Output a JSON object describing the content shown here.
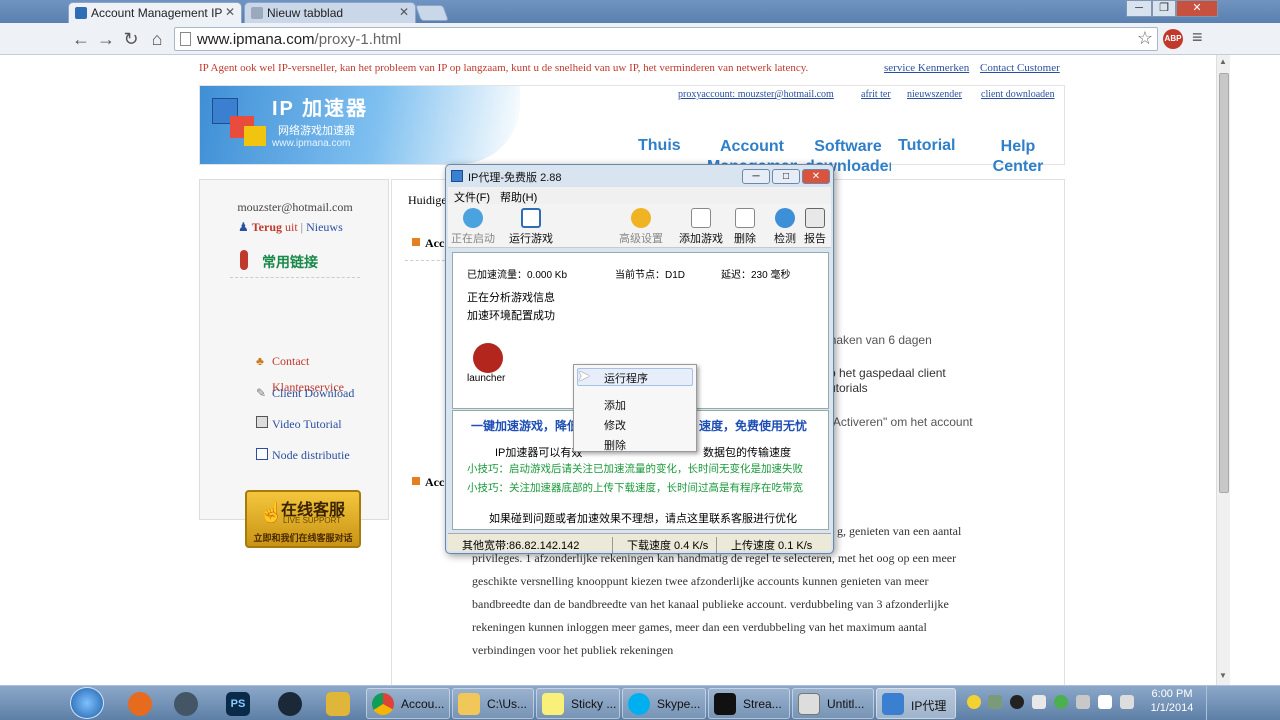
{
  "browser": {
    "tabs": [
      {
        "label": "Account Management IP"
      },
      {
        "label": "Nieuw tabblad"
      }
    ],
    "url_host": "www.ipmana.com",
    "url_path": "/proxy-1.html",
    "abp_label": "ABP"
  },
  "page": {
    "top_notice": "IP Agent ook wel IP-versneller, kan het probleem van IP op langzaam, kunt u de snelheid van uw IP, het verminderen van netwerk latency.",
    "top_links": [
      "service Kenmerken",
      "Contact Customer"
    ],
    "logo": {
      "title": "IP 加速器",
      "subtitle": "网络游戏加速器",
      "url": "www.ipmana.com"
    },
    "header_links": [
      "proxyaccount: mouzster@hotmail.com",
      "afrit ter",
      "nieuwszender",
      "client downloaden"
    ],
    "main_nav": [
      "Thuis",
      "Account Management",
      "Software downloaden",
      "Tutorial",
      "Help Center"
    ],
    "sidebar": {
      "email": "mouzster@hotmail.com",
      "back_label": "Terug",
      "uit": "uit",
      "sep": "|",
      "news": "Nieuws",
      "section_title": "常用链接",
      "links": [
        "Contact",
        "Klantenservice",
        "Client Download",
        "Video Tutorial",
        "Node distributie"
      ],
      "chat": {
        "title": "在线客服",
        "sub": "LIVE SUPPORT",
        "footer": "立即和我们在线客服对话"
      }
    },
    "content": {
      "huidige": "Huidige",
      "acc1": "Acc",
      "acc2": "Acc",
      "text_right_1": "k maken van 6 dagen",
      "text_right_2a": "p het gaspedaal client",
      "text_right_2b": "utorials",
      "text_right_3": "\" Activeren\" om het account",
      "text_right_4": "g, genieten van een aantal",
      "paragraph": [
        "privileges. 1 afzonderlijke rekeningen kan handmatig de regel te selecteren, met het oog op een meer",
        "geschikte versnelling knooppunt kiezen twee afzonderlijke accounts kunnen genieten van meer",
        "bandbreedte dan de bandbreedte van het kanaal publieke account. verdubbeling van 3 afzonderlijke",
        "rekeningen kunnen inloggen meer games, meer dan een verdubbeling van het maximum aantal",
        "verbindingen voor het publiek rekeningen"
      ]
    }
  },
  "dialog": {
    "title": "IP代理-免费版 2.88",
    "menu": [
      "文件(F)",
      "帮助(H)"
    ],
    "tools": [
      "正在启动",
      "运行游戏",
      "高级设置",
      "添加游戏",
      "删除",
      "检测",
      "报告"
    ],
    "stats": {
      "accel_label": "已加速流量：",
      "accel_value": "0.000 Kb",
      "node_label": "当前节点：",
      "node_value": "D1D",
      "latency_label": "延迟：",
      "latency_value": "230 毫秒"
    },
    "log": [
      "正在分析游戏信息",
      "加速环境配置成功"
    ],
    "game_label": "launcher",
    "promo_title": "一键加速游戏，降低",
    "promo_title_right": "速度，免费使用无忧",
    "promo_line1": "IP加速器可以有效",
    "promo_line1_right": "数据包的传输速度",
    "tip1": "小技巧：启动游戏后请关注已加速流量的变化，长时间无变化是加速失败",
    "tip2": "小技巧：关注加速器底部的上传下载速度，长时间过高是有程序在吃带宽",
    "help_line": "如果碰到问题或者加速效果不理想，请点这里联系客服进行优化",
    "status": {
      "bandwidth": "其他宽带:86.82.142.142",
      "download": "下载速度 0.4 K/s",
      "upload": "上传速度 0.1 K/s"
    },
    "context_menu": [
      "运行程序",
      "添加",
      "修改",
      "删除"
    ]
  },
  "taskbar": {
    "buttons": [
      "Accou...",
      "C:\\Us...",
      "Sticky ...",
      "Skype...",
      "Strea...",
      "Untitl...",
      "IP代理"
    ],
    "pinned": [
      "PS"
    ],
    "time": "6:00 PM",
    "date": "1/1/2014"
  },
  "colors": {
    "accent": "#2f7fc9",
    "red_text": "#c0392b",
    "link_blue": "#2a4fa0",
    "tip_green": "#1a9a3a"
  }
}
